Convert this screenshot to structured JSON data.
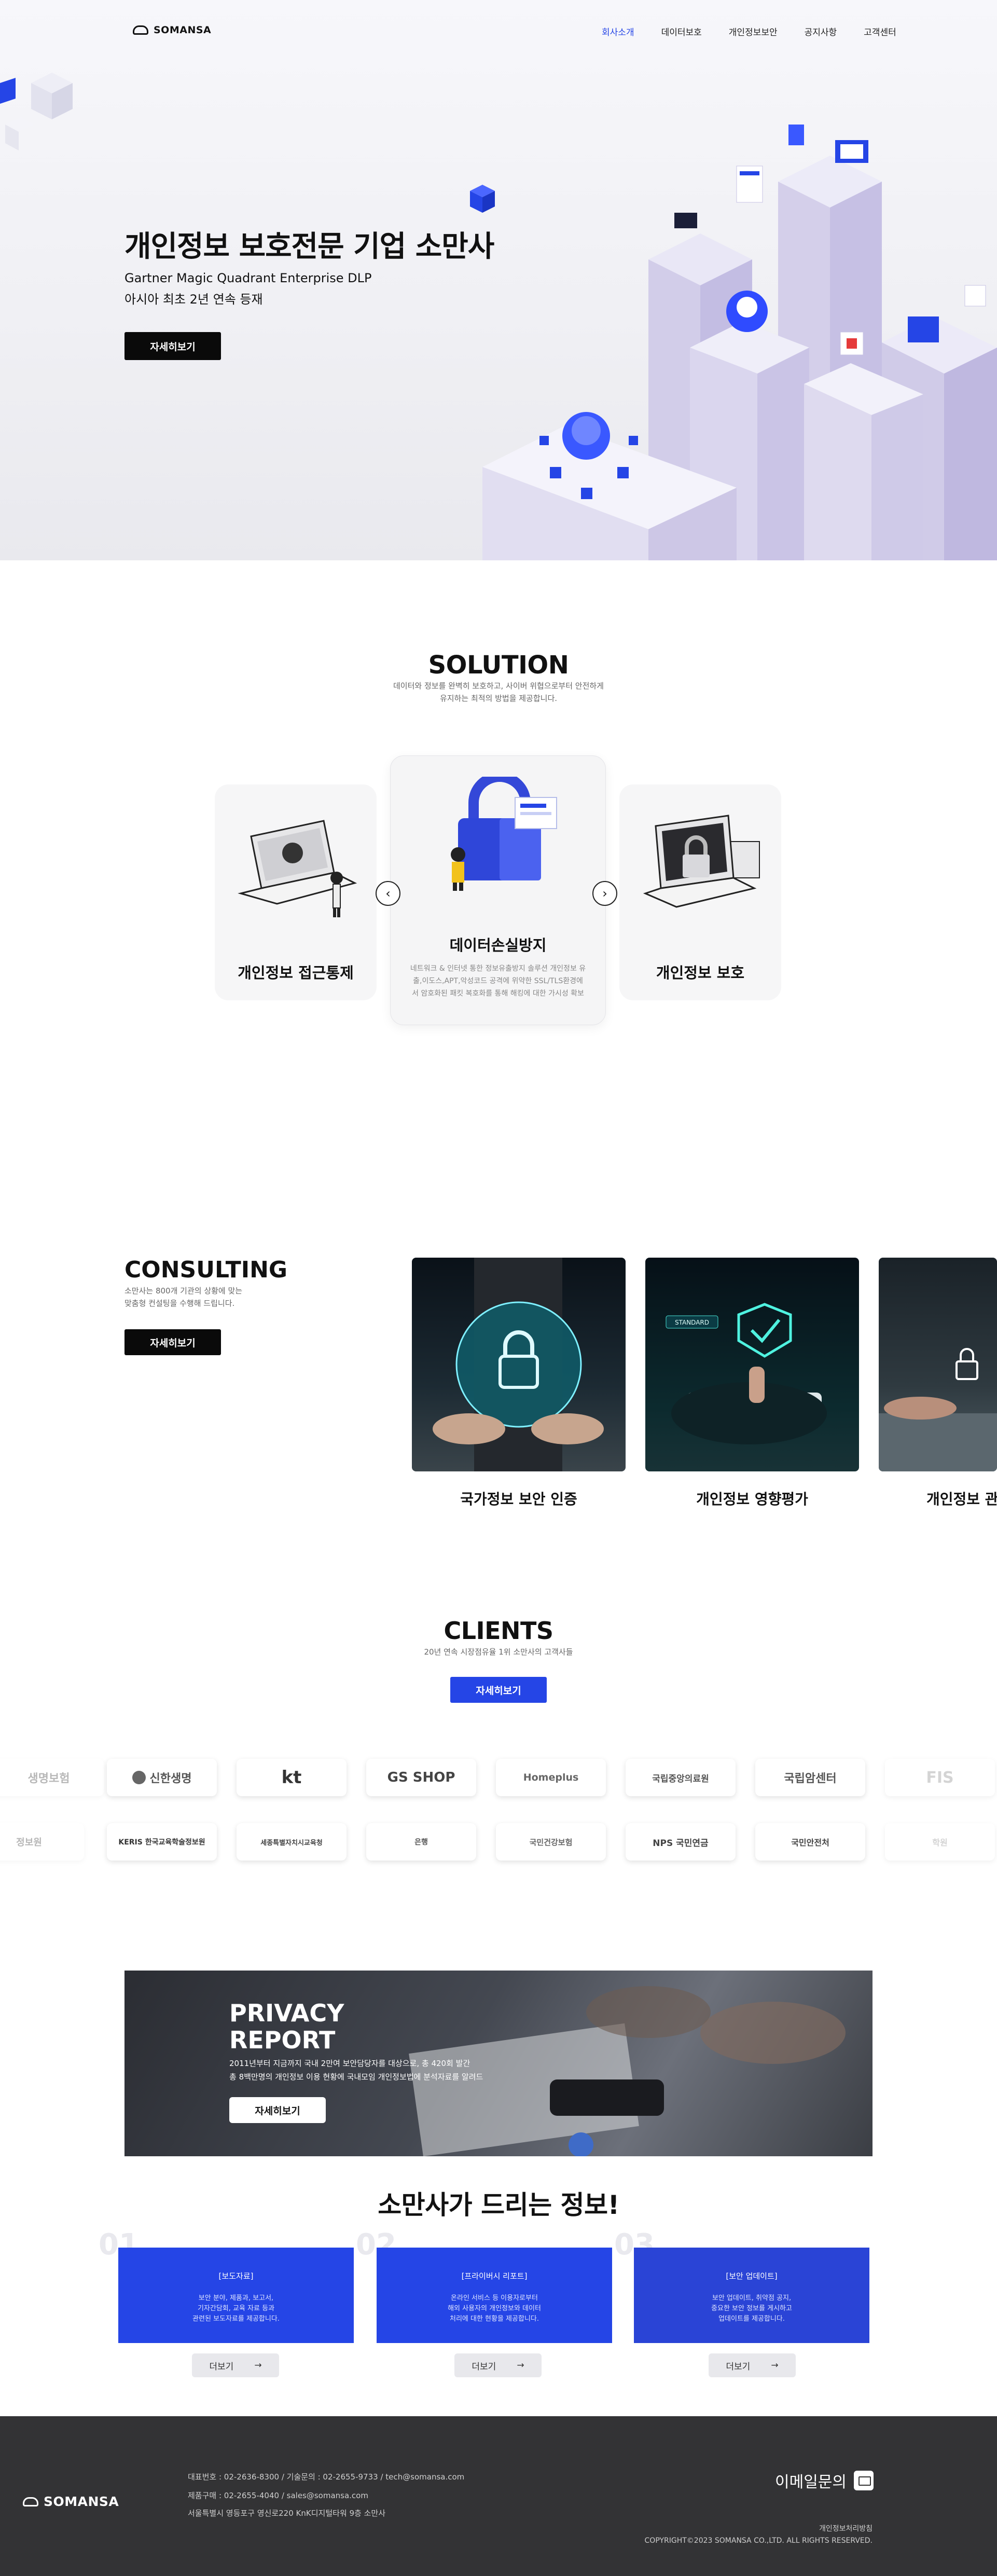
{
  "header": {
    "brand": "SOMANSA",
    "nav": [
      "회사소개",
      "데이터보호",
      "개인정보보안",
      "공지사항",
      "고객센터"
    ]
  },
  "hero": {
    "title": "개인정보 보호전문 기업 소만사",
    "sub1": "Gartner Magic Quadrant Enterprise DLP",
    "sub2": "아시아 최초 2년 연속 등재",
    "button": "자세히보기"
  },
  "solution": {
    "title": "SOLUTION",
    "desc1": "데이터와 정보를 완벽히 보호하고, 사이버 위협으로부터 안전하게",
    "desc2": "유지하는 최적의 방법을 제공합니다.",
    "cards": [
      {
        "label": "개인정보 접근통제"
      },
      {
        "label": "데이터손실방지",
        "body1": "네트워크 & 인터넷 통한 정보유출방지 솔루션 개인정보 유",
        "body2": "출,이도스,APT,악성코드 공격에 위약한 SSL/TLS환경에",
        "body3": "서 암호화된 패킷 복호화를 통해 해킹에 대한 가시성 확보"
      },
      {
        "label": "개인정보 보호"
      }
    ]
  },
  "consulting": {
    "title": "CONSULTING",
    "desc1": "소만사는 800개 기관의 상황에 맞는",
    "desc2": "맞춤형 컨설팅을 수행해 드립니다.",
    "button": "자세히보기",
    "items": [
      {
        "caption": "국가정보 보안 인증"
      },
      {
        "caption": "개인정보 영향평가"
      },
      {
        "caption": "개인정보 관"
      }
    ],
    "standard_label": "STANDARD"
  },
  "clients": {
    "title": "CLIENTS",
    "desc": "20년 연속 시장점유율 1위 소만사의 고객사들",
    "button": "자세히보기",
    "row1": [
      "생명보험",
      "신한생명",
      "kt",
      "GS SHOP",
      "Homeplus",
      "국립중앙의료원",
      "국립암센터",
      "FIS"
    ],
    "row2": [
      "정보원",
      "KERIS 한국교육학술정보원",
      "세종특별자치시교육청",
      "은행",
      "국민건강보험",
      "NPS 국민연금",
      "국민안전처",
      "학원"
    ]
  },
  "report": {
    "title1": "PRIVACY",
    "title2": "REPORT",
    "desc1": "2011년부터 지금까지 국내 2만여 보안담당자를 대상으로, 총 420회 발간",
    "desc2": "총 8백만명의 개인정보 이용 현황에 국내모임 개인정보법에 분석자료를 알려드",
    "button": "자세히보기"
  },
  "info": {
    "title": "소만사가 드리는 정보!",
    "cards": [
      {
        "num": "01",
        "tag": "[보도자료]",
        "d1": "보안 분야, 제품과, 보고서,",
        "d2": "기자간담회, 교육 자료 등과",
        "d3": "관련된 보도자료를 제공합니다.",
        "more": "더보기"
      },
      {
        "num": "02",
        "tag": "[프라이버시 리포트]",
        "d1": "온라인 서비스 등 이용자로부터",
        "d2": "해외 사용자의 개인정보와 데이터",
        "d3": "처리에 대한 현황을 제공합니다.",
        "more": "더보기"
      },
      {
        "num": "03",
        "tag": "[보안 업데이트]",
        "d1": "보안 업데이트, 취약점 공지,",
        "d2": "중요한 보안 정보를 게시하고",
        "d3": "업데이트를 제공합니다.",
        "more": "더보기"
      }
    ]
  },
  "footer": {
    "brand": "SOMANSA",
    "line1": "대표번호 : 02-2636-8300 / 기술문의 : 02-2655-9733 / tech@somansa.com",
    "line2": "제품구매 : 02-2655-4040 / sales@somansa.com",
    "line3": "서울특별시 영등포구 영신로220 KnK디지털타워 9층 소만사",
    "mail": "이메일문의",
    "privacy": "개인정보처리방침",
    "copyright": "COPYRIGHT©2023 SOMANSA CO.,LTD. ALL RIGHTS RESERVED."
  }
}
